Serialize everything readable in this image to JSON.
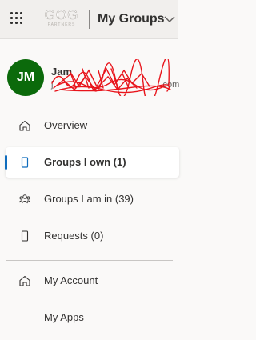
{
  "header": {
    "waffle_icon": "app-launcher-icon",
    "logo_main": "GOG",
    "logo_sub": "PARTNERS",
    "app_title": "My Groups",
    "dropdown_icon": "chevron-down-icon"
  },
  "user": {
    "initials": "JM",
    "name": "Jam",
    "email_prefix": "j",
    "email_suffix": ".com",
    "avatar_color": "#0b6a0b",
    "redaction_color": "#e8141b"
  },
  "nav": {
    "items": [
      {
        "label": "Overview",
        "icon": "home-icon"
      },
      {
        "label": "Groups I own (1)",
        "icon": "mobile-icon",
        "selected": true
      },
      {
        "label": "Groups I am in (39)",
        "icon": "people-icon"
      },
      {
        "label": "Requests (0)",
        "icon": "mobile-icon"
      }
    ],
    "secondary": [
      {
        "label": "My Account",
        "icon": "home-icon"
      },
      {
        "label": "My Apps"
      }
    ]
  },
  "colors": {
    "accent": "#0f6cbd",
    "text": "#323130",
    "background": "#faf9f8"
  }
}
